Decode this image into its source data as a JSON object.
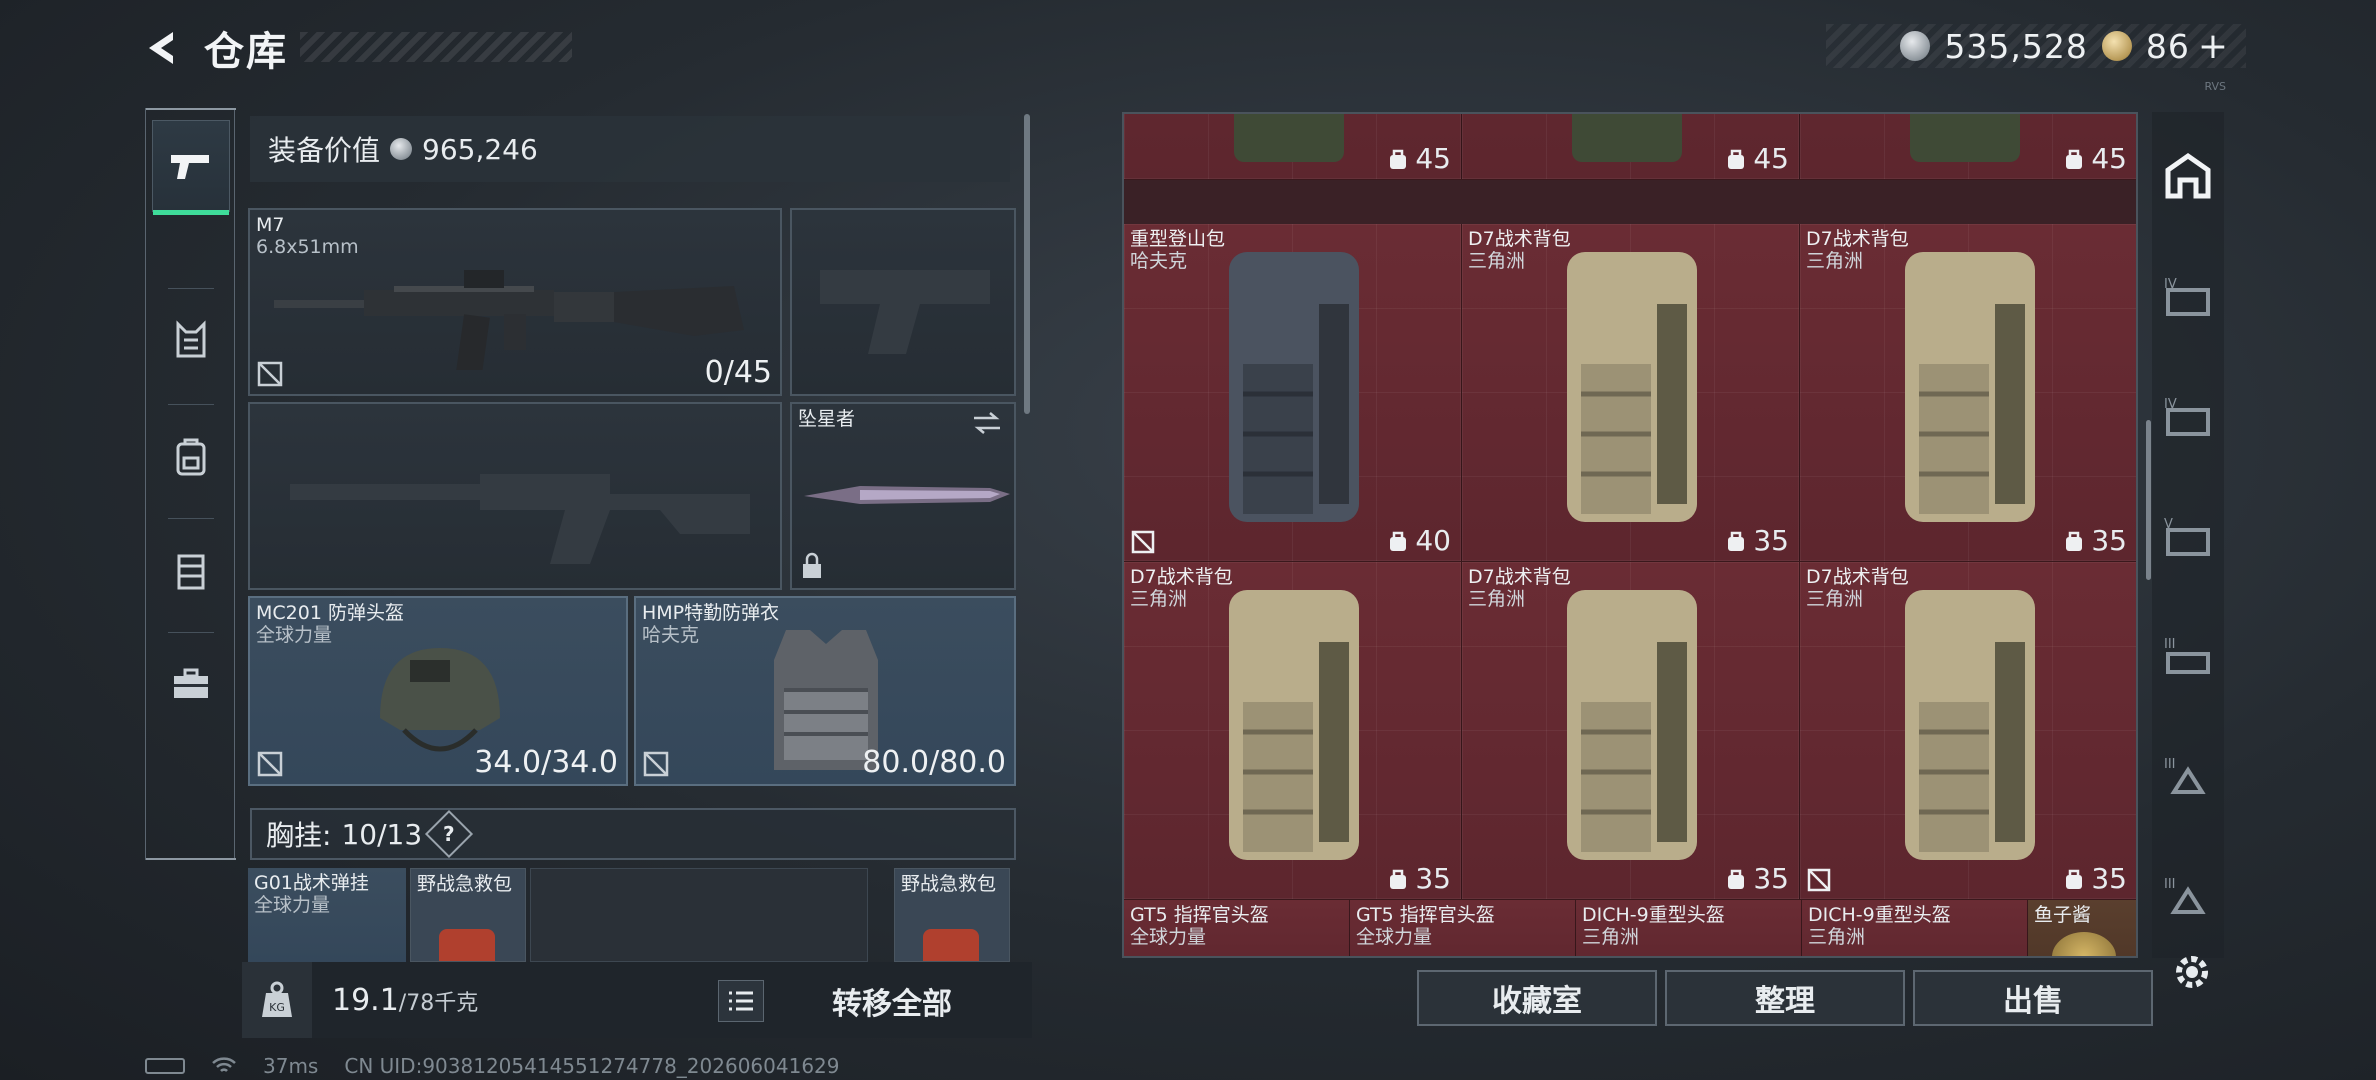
{
  "header": {
    "title": "仓库"
  },
  "currency": {
    "silver": "535,528",
    "gold": "86",
    "plus": "+"
  },
  "corner_tag": "RVS",
  "equipment": {
    "value_label": "装备价值",
    "value": "965,246",
    "primary_weapon": {
      "name": "M7",
      "caliber": "6.8x51mm",
      "ammo": "0/45"
    },
    "melee": {
      "name": "坠星者"
    },
    "helmet": {
      "name": "MC201 防弹头盔",
      "brand": "全球力量",
      "durability": "34.0/34.0"
    },
    "armor": {
      "name": "HMP特勤防弹衣",
      "brand": "哈夫克",
      "durability": "80.0/80.0"
    },
    "chest_label": "胸挂:",
    "chest_count": "10/13",
    "chest_help": "?",
    "rig": {
      "name": "G01战术弹挂",
      "brand": "全球力量"
    },
    "medkit1": {
      "name": "野战急救包"
    },
    "medkit2": {
      "name": "野战急救包"
    }
  },
  "bottom": {
    "weight": "19.1",
    "weight_max": "/78千克",
    "transfer_label": "转移全部"
  },
  "stash": {
    "top_row": [
      {
        "cap": "45"
      },
      {
        "cap": "45"
      },
      {
        "cap": "45"
      }
    ],
    "rows": [
      [
        {
          "name": "重型登山包",
          "brand": "哈夫克",
          "cap": "40"
        },
        {
          "name": "D7战术背包",
          "brand": "三角洲",
          "cap": "35"
        },
        {
          "name": "D7战术背包",
          "brand": "三角洲",
          "cap": "35"
        }
      ],
      [
        {
          "name": "D7战术背包",
          "brand": "三角洲",
          "cap": "35"
        },
        {
          "name": "D7战术背包",
          "brand": "三角洲",
          "cap": "35"
        },
        {
          "name": "D7战术背包",
          "brand": "三角洲",
          "cap": "35"
        }
      ]
    ],
    "bottom_row": [
      {
        "name": "GT5 指挥官头盔",
        "brand": "全球力量"
      },
      {
        "name": "GT5 指挥官头盔",
        "brand": "全球力量"
      },
      {
        "name": "DICH-9重型头盔",
        "brand": "三角洲"
      },
      {
        "name": "DICH-9重型头盔",
        "brand": "三角洲"
      },
      {
        "name": "鱼子酱",
        "brand": ""
      }
    ]
  },
  "buttons": {
    "collection": "收藏室",
    "organize": "整理",
    "sell": "出售"
  },
  "right_tabs": [
    "backpack",
    "IV",
    "IV",
    "V",
    "III",
    "III",
    "III"
  ],
  "status": {
    "ping": "37ms",
    "uid": "CN UID:90381205414551274778_202606041629"
  },
  "colors": {
    "accent": "#3fdc9a",
    "stash_bg": "#6a2c34"
  }
}
